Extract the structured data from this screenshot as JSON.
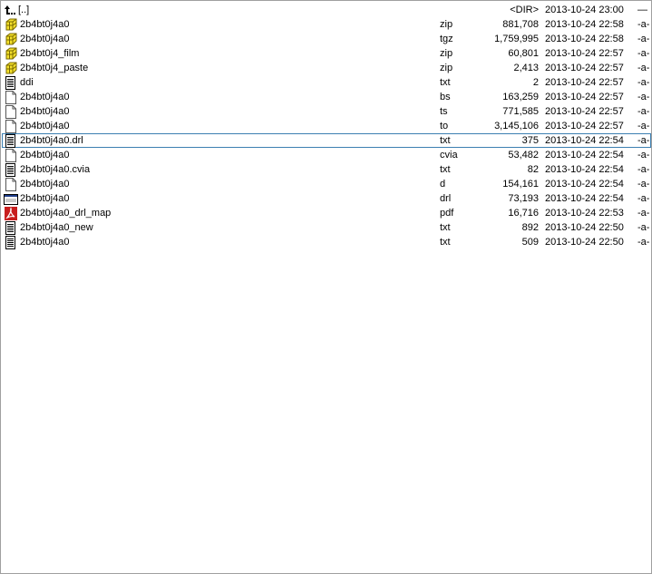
{
  "parent_row": {
    "name": "[..]",
    "size": "<DIR>",
    "date": "2013-10-24 23:00",
    "attr": "—",
    "icon": "up-folder-icon"
  },
  "files": [
    {
      "name": "2b4bt0j4a0",
      "ext": "zip",
      "size": "881,708",
      "date": "2013-10-24 22:58",
      "attr": "-a-",
      "icon": "archive"
    },
    {
      "name": "2b4bt0j4a0",
      "ext": "tgz",
      "size": "1,759,995",
      "date": "2013-10-24 22:58",
      "attr": "-a-",
      "icon": "archive"
    },
    {
      "name": "2b4bt0j4_film",
      "ext": "zip",
      "size": "60,801",
      "date": "2013-10-24 22:57",
      "attr": "-a-",
      "icon": "archive"
    },
    {
      "name": "2b4bt0j4_paste",
      "ext": "zip",
      "size": "2,413",
      "date": "2013-10-24 22:57",
      "attr": "-a-",
      "icon": "archive"
    },
    {
      "name": "ddi",
      "ext": "txt",
      "size": "2",
      "date": "2013-10-24 22:57",
      "attr": "-a-",
      "icon": "text"
    },
    {
      "name": "2b4bt0j4a0",
      "ext": "bs",
      "size": "163,259",
      "date": "2013-10-24 22:57",
      "attr": "-a-",
      "icon": "blank"
    },
    {
      "name": "2b4bt0j4a0",
      "ext": "ts",
      "size": "771,585",
      "date": "2013-10-24 22:57",
      "attr": "-a-",
      "icon": "blank"
    },
    {
      "name": "2b4bt0j4a0",
      "ext": "to",
      "size": "3,145,106",
      "date": "2013-10-24 22:57",
      "attr": "-a-",
      "icon": "blank"
    },
    {
      "name": "2b4bt0j4a0.drl",
      "ext": "txt",
      "size": "375",
      "date": "2013-10-24 22:54",
      "attr": "-a-",
      "icon": "text",
      "selected": true
    },
    {
      "name": "2b4bt0j4a0",
      "ext": "cvia",
      "size": "53,482",
      "date": "2013-10-24 22:54",
      "attr": "-a-",
      "icon": "blank"
    },
    {
      "name": "2b4bt0j4a0.cvia",
      "ext": "txt",
      "size": "82",
      "date": "2013-10-24 22:54",
      "attr": "-a-",
      "icon": "text"
    },
    {
      "name": "2b4bt0j4a0",
      "ext": "d",
      "size": "154,161",
      "date": "2013-10-24 22:54",
      "attr": "-a-",
      "icon": "blank"
    },
    {
      "name": "2b4bt0j4a0",
      "ext": "drl",
      "size": "73,193",
      "date": "2013-10-24 22:54",
      "attr": "-a-",
      "icon": "window"
    },
    {
      "name": "2b4bt0j4a0_drl_map",
      "ext": "pdf",
      "size": "16,716",
      "date": "2013-10-24 22:53",
      "attr": "-a-",
      "icon": "pdf"
    },
    {
      "name": "2b4bt0j4a0_new",
      "ext": "txt",
      "size": "892",
      "date": "2013-10-24 22:50",
      "attr": "-a-",
      "icon": "text"
    },
    {
      "name": "2b4bt0j4a0",
      "ext": "txt",
      "size": "509",
      "date": "2013-10-24 22:50",
      "attr": "-a-",
      "icon": "text"
    }
  ],
  "colors": {
    "selection_border": "#3c7fb1",
    "archive_fill": "#f5e12a",
    "pdf_red": "#c81e1e",
    "window_title": "#1f3d8a"
  }
}
